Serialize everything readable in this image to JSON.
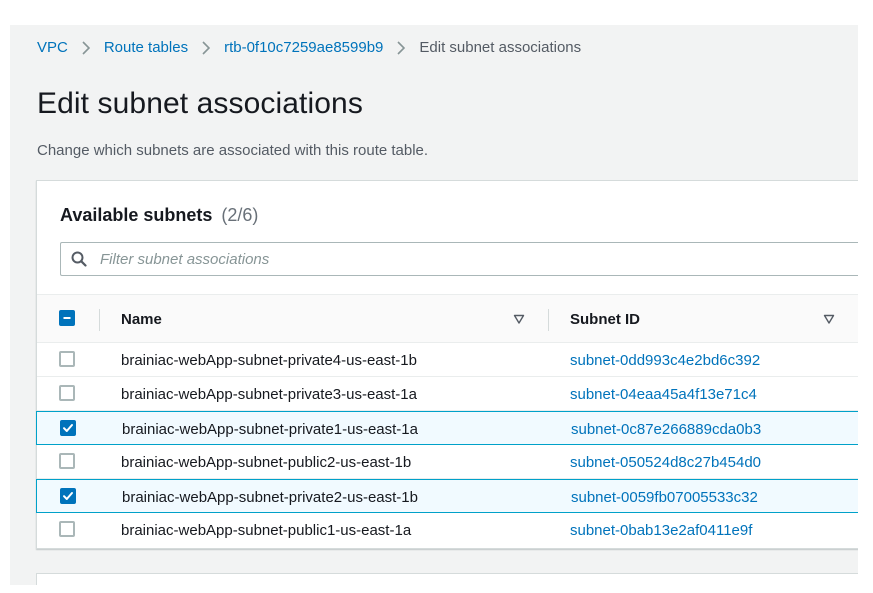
{
  "breadcrumb": {
    "items": [
      "VPC",
      "Route tables",
      "rtb-0f10c7259ae8599b9"
    ],
    "current": "Edit subnet associations"
  },
  "page": {
    "title": "Edit subnet associations",
    "description": "Change which subnets are associated with this route table."
  },
  "panel": {
    "title": "Available subnets",
    "count": "(2/6)",
    "filter_placeholder": "Filter subnet associations"
  },
  "table": {
    "columns": [
      "Name",
      "Subnet ID"
    ],
    "rows": [
      {
        "name": "brainiac-webApp-subnet-private4-us-east-1b",
        "subnet_id": "subnet-0dd993c4e2bd6c392",
        "selected": false
      },
      {
        "name": "brainiac-webApp-subnet-private3-us-east-1a",
        "subnet_id": "subnet-04eaa45a4f13e71c4",
        "selected": false
      },
      {
        "name": "brainiac-webApp-subnet-private1-us-east-1a",
        "subnet_id": "subnet-0c87e266889cda0b3",
        "selected": true
      },
      {
        "name": "brainiac-webApp-subnet-public2-us-east-1b",
        "subnet_id": "subnet-050524d8c27b454d0",
        "selected": false
      },
      {
        "name": "brainiac-webApp-subnet-private2-us-east-1b",
        "subnet_id": "subnet-0059fb07005533c32",
        "selected": true
      },
      {
        "name": "brainiac-webApp-subnet-public1-us-east-1a",
        "subnet_id": "subnet-0bab13e2af0411e9f",
        "selected": false
      }
    ]
  },
  "colors": {
    "link": "#0073bb",
    "selected_border": "#00a1c9",
    "selected_bg": "#f1faff",
    "checkbox_checked": "#0073bb"
  },
  "icons": {
    "breadcrumb_separator": "chevron-right-icon",
    "filter": "search-icon",
    "sort": "caret-down-icon",
    "header_checkbox": "indeterminate-checkbox"
  }
}
